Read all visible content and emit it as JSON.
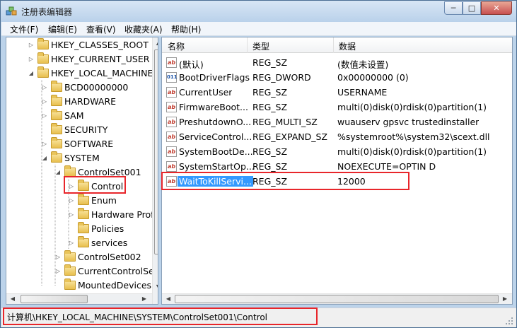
{
  "window": {
    "title": "注册表编辑器"
  },
  "caption_buttons": {
    "minimize": "─",
    "maximize": "□",
    "close": "✕"
  },
  "menu": [
    "文件(F)",
    "编辑(E)",
    "查看(V)",
    "收藏夹(A)",
    "帮助(H)"
  ],
  "tree": {
    "items": [
      {
        "label": "HKEY_CLASSES_ROOT",
        "expander": "▷"
      },
      {
        "label": "HKEY_CURRENT_USER",
        "expander": "▷"
      },
      {
        "label": "HKEY_LOCAL_MACHINE",
        "expander": "◢"
      },
      {
        "label": "BCD00000000",
        "expander": "▷"
      },
      {
        "label": "HARDWARE",
        "expander": "▷"
      },
      {
        "label": "SAM",
        "expander": "▷"
      },
      {
        "label": "SECURITY",
        "expander": ""
      },
      {
        "label": "SOFTWARE",
        "expander": "▷"
      },
      {
        "label": "SYSTEM",
        "expander": "◢"
      },
      {
        "label": "ControlSet001",
        "expander": "◢"
      },
      {
        "label": "Control",
        "expander": "▷"
      },
      {
        "label": "Enum",
        "expander": "▷"
      },
      {
        "label": "Hardware Profiles",
        "expander": "▷"
      },
      {
        "label": "Policies",
        "expander": ""
      },
      {
        "label": "services",
        "expander": "▷"
      },
      {
        "label": "ControlSet002",
        "expander": "▷"
      },
      {
        "label": "CurrentControlSet",
        "expander": "▷"
      },
      {
        "label": "MountedDevices",
        "expander": ""
      }
    ]
  },
  "list": {
    "headers": {
      "name": "名称",
      "type": "类型",
      "data": "数据"
    },
    "rows": [
      {
        "name": "(默认)",
        "type": "REG_SZ",
        "data": "(数值未设置)",
        "icon": "ab"
      },
      {
        "name": "BootDriverFlags",
        "type": "REG_DWORD",
        "data": "0x00000000 (0)",
        "icon": "bin"
      },
      {
        "name": "CurrentUser",
        "type": "REG_SZ",
        "data": "USERNAME",
        "icon": "ab"
      },
      {
        "name": "FirmwareBoot...",
        "type": "REG_SZ",
        "data": "multi(0)disk(0)rdisk(0)partition(1)",
        "icon": "ab"
      },
      {
        "name": "PreshutdownO...",
        "type": "REG_MULTI_SZ",
        "data": "wuauserv gpsvc trustedinstaller",
        "icon": "ab"
      },
      {
        "name": "ServiceControl...",
        "type": "REG_EXPAND_SZ",
        "data": "%systemroot%\\system32\\scext.dll",
        "icon": "ab"
      },
      {
        "name": "SystemBootDe...",
        "type": "REG_SZ",
        "data": "multi(0)disk(0)rdisk(0)partition(1)",
        "icon": "ab"
      },
      {
        "name": "SystemStartOp...",
        "type": "REG_SZ",
        "data": " NOEXECUTE=OPTIN D",
        "icon": "ab"
      },
      {
        "name": "WaitToKillServi...",
        "type": "REG_SZ",
        "data": "12000",
        "icon": "ab"
      }
    ]
  },
  "status": {
    "path": "计算机\\HKEY_LOCAL_MACHINE\\SYSTEM\\ControlSet001\\Control"
  },
  "colors": {
    "highlight": "#e8262b",
    "selection": "#3399ff"
  }
}
